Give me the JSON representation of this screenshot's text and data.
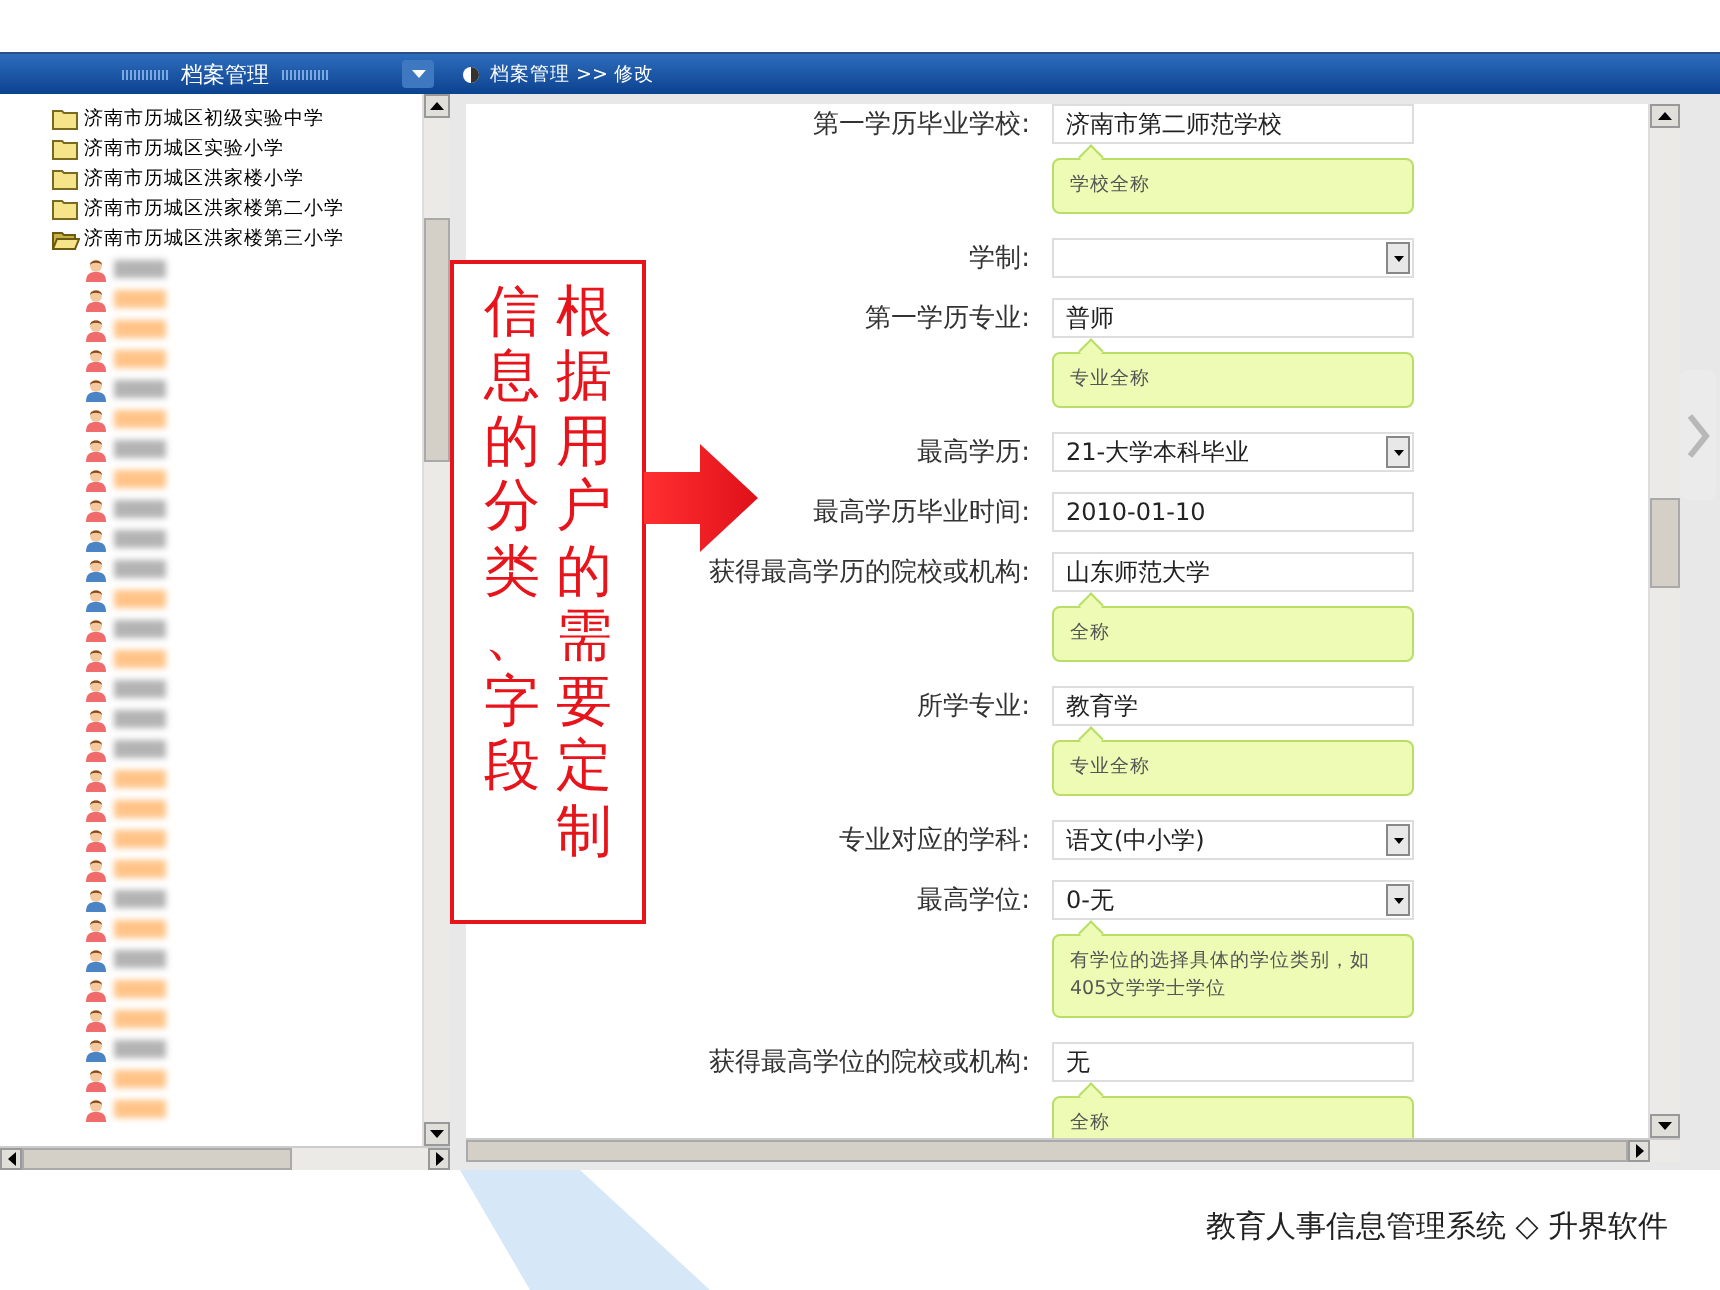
{
  "tree_panel": {
    "title": "档案管理"
  },
  "tree": [
    {
      "kind": "folder",
      "label": "济南市历城区初级实验中学",
      "expanded": false
    },
    {
      "kind": "folder",
      "label": "济南市历城区实验小学",
      "expanded": false
    },
    {
      "kind": "folder",
      "label": "济南市历城区洪家楼小学",
      "expanded": false
    },
    {
      "kind": "folder",
      "label": "济南市历城区洪家楼第二小学",
      "expanded": false
    },
    {
      "kind": "folder",
      "label": "济南市历城区洪家楼第三小学",
      "expanded": true,
      "children": [
        {
          "kind": "person",
          "color": "#f06b6b",
          "highlighted": false
        },
        {
          "kind": "person",
          "color": "#f06b6b",
          "highlighted": true
        },
        {
          "kind": "person",
          "color": "#f06b6b",
          "highlighted": true
        },
        {
          "kind": "person",
          "color": "#f06b6b",
          "highlighted": true
        },
        {
          "kind": "person",
          "color": "#4a84c4",
          "highlighted": false
        },
        {
          "kind": "person",
          "color": "#f06b6b",
          "highlighted": true
        },
        {
          "kind": "person",
          "color": "#f06b6b",
          "highlighted": false
        },
        {
          "kind": "person",
          "color": "#f06b6b",
          "highlighted": true
        },
        {
          "kind": "person",
          "color": "#f06b6b",
          "highlighted": false
        },
        {
          "kind": "person",
          "color": "#4a84c4",
          "highlighted": false
        },
        {
          "kind": "person",
          "color": "#4a84c4",
          "highlighted": false
        },
        {
          "kind": "person",
          "color": "#4a84c4",
          "highlighted": true
        },
        {
          "kind": "person",
          "color": "#f06b6b",
          "highlighted": false
        },
        {
          "kind": "person",
          "color": "#f06b6b",
          "highlighted": true
        },
        {
          "kind": "person",
          "color": "#f06b6b",
          "highlighted": false
        },
        {
          "kind": "person",
          "color": "#f06b6b",
          "highlighted": false
        },
        {
          "kind": "person",
          "color": "#f06b6b",
          "highlighted": false
        },
        {
          "kind": "person",
          "color": "#f06b6b",
          "highlighted": true
        },
        {
          "kind": "person",
          "color": "#f06b6b",
          "highlighted": true
        },
        {
          "kind": "person",
          "color": "#f06b6b",
          "highlighted": true
        },
        {
          "kind": "person",
          "color": "#f06b6b",
          "highlighted": true
        },
        {
          "kind": "person",
          "color": "#4a84c4",
          "highlighted": false
        },
        {
          "kind": "person",
          "color": "#f06b6b",
          "highlighted": true
        },
        {
          "kind": "person",
          "color": "#4a84c4",
          "highlighted": false
        },
        {
          "kind": "person",
          "color": "#f06b6b",
          "highlighted": true
        },
        {
          "kind": "person",
          "color": "#f06b6b",
          "highlighted": true
        },
        {
          "kind": "person",
          "color": "#4a84c4",
          "highlighted": false
        },
        {
          "kind": "person",
          "color": "#f06b6b",
          "highlighted": true
        },
        {
          "kind": "person",
          "color": "#f06b6b",
          "highlighted": true
        }
      ]
    }
  ],
  "breadcrumb": "档案管理 >> 修改",
  "form": [
    {
      "label": "第一学历毕业学校:",
      "kind": "text",
      "value": "济南市第二师范学校",
      "tip": "学校全称"
    },
    {
      "label": "学制:",
      "kind": "select"
    },
    {
      "label": "第一学历专业:",
      "kind": "text",
      "value": "普师",
      "tip": "专业全称"
    },
    {
      "label": "最高学历:",
      "kind": "select",
      "value": "21-大学本科毕业"
    },
    {
      "label": "最高学历毕业时间:",
      "kind": "text",
      "value": "2010-01-10"
    },
    {
      "label": "获得最高学历的院校或机构:",
      "kind": "text",
      "value": "山东师范大学",
      "tip": "全称"
    },
    {
      "label": "所学专业:",
      "kind": "text",
      "value": "教育学",
      "tip": "专业全称"
    },
    {
      "label": "专业对应的学科:",
      "kind": "select",
      "value": "语文(中小学)"
    },
    {
      "label": "最高学位:",
      "kind": "select",
      "value": "0-无",
      "tip": "有学位的选择具体的学位类别，如405文学学士学位"
    },
    {
      "label": "获得最高学位的院校或机构:",
      "kind": "text",
      "value": "无",
      "tip": "全称"
    }
  ],
  "annotation": [
    "信息的分类、字段",
    "根据用户的需要定制"
  ],
  "footer": "教育人事信息管理系统 ◇ 升界软件"
}
